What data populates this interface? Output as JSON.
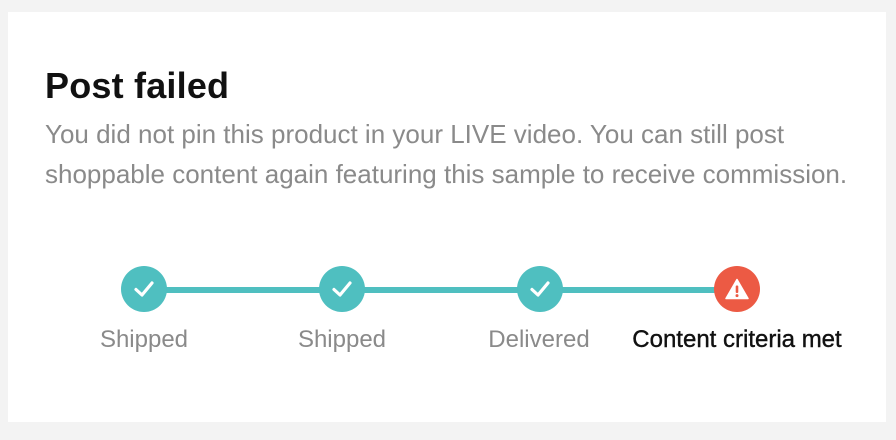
{
  "card": {
    "title": "Post failed",
    "description": "You did not pin this product in your LIVE video. You can still post shoppable content again featuring this sample to receive commission."
  },
  "steps": [
    {
      "label": "Shipped",
      "status": "complete",
      "icon": "check-icon"
    },
    {
      "label": "Shipped",
      "status": "complete",
      "icon": "check-icon"
    },
    {
      "label": "Delivered",
      "status": "complete",
      "icon": "check-icon"
    },
    {
      "label": "Content criteria met",
      "status": "failed",
      "icon": "warning-icon"
    }
  ],
  "colors": {
    "complete": "#4fbfc0",
    "failed": "#ec5a44",
    "title": "#111111",
    "muted": "#8a8a8a"
  }
}
